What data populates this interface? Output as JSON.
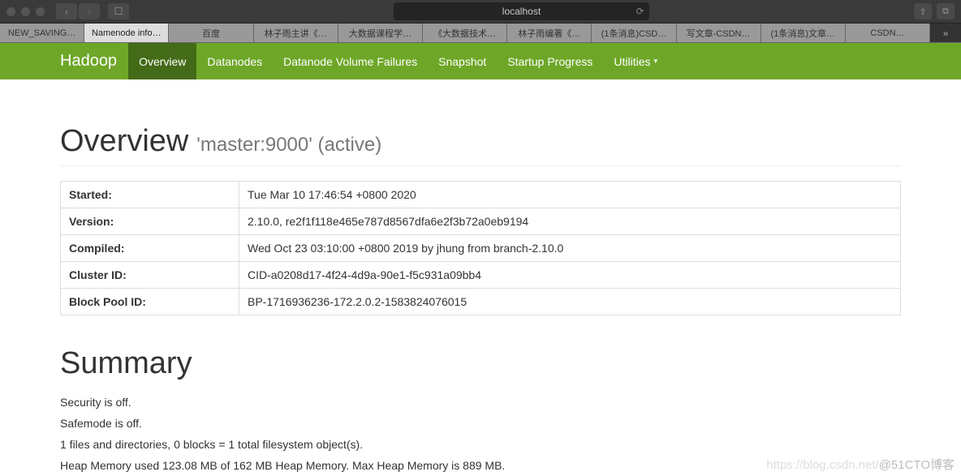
{
  "browser": {
    "url": "localhost",
    "tabs": [
      {
        "label": "NEW_SAVING…",
        "active": false
      },
      {
        "label": "Namenode info…",
        "active": true
      },
      {
        "label": "百度",
        "active": false
      },
      {
        "label": "林子雨主讲《…",
        "active": false
      },
      {
        "label": "大数据课程学…",
        "active": false
      },
      {
        "label": "《大数据技术…",
        "active": false
      },
      {
        "label": "林子雨编著《…",
        "active": false
      },
      {
        "label": "(1条消息)CSD…",
        "active": false
      },
      {
        "label": "写文章-CSDN…",
        "active": false
      },
      {
        "label": "(1条消息)文章…",
        "active": false
      },
      {
        "label": "CSDN…",
        "active": false
      }
    ]
  },
  "nav": {
    "brand": "Hadoop",
    "items": [
      {
        "label": "Overview",
        "active": true
      },
      {
        "label": "Datanodes",
        "active": false
      },
      {
        "label": "Datanode Volume Failures",
        "active": false
      },
      {
        "label": "Snapshot",
        "active": false
      },
      {
        "label": "Startup Progress",
        "active": false
      },
      {
        "label": "Utilities",
        "active": false,
        "dropdown": true
      }
    ]
  },
  "overview": {
    "heading": "Overview",
    "subtitle": "'master:9000' (active)",
    "rows": [
      {
        "label": "Started:",
        "value": "Tue Mar 10 17:46:54 +0800 2020"
      },
      {
        "label": "Version:",
        "value": "2.10.0, re2f1f118e465e787d8567dfa6e2f3b72a0eb9194"
      },
      {
        "label": "Compiled:",
        "value": "Wed Oct 23 03:10:00 +0800 2019 by jhung from branch-2.10.0"
      },
      {
        "label": "Cluster ID:",
        "value": "CID-a0208d17-4f24-4d9a-90e1-f5c931a09bb4"
      },
      {
        "label": "Block Pool ID:",
        "value": "BP-1716936236-172.2.0.2-1583824076015"
      }
    ]
  },
  "summary": {
    "heading": "Summary",
    "lines": [
      "Security is off.",
      "Safemode is off.",
      "1 files and directories, 0 blocks = 1 total filesystem object(s).",
      "Heap Memory used 123.08 MB of 162 MB Heap Memory. Max Heap Memory is 889 MB."
    ]
  },
  "watermark": {
    "faint": "https://blog.csdn.net/",
    "text": "@51CTO博客"
  }
}
